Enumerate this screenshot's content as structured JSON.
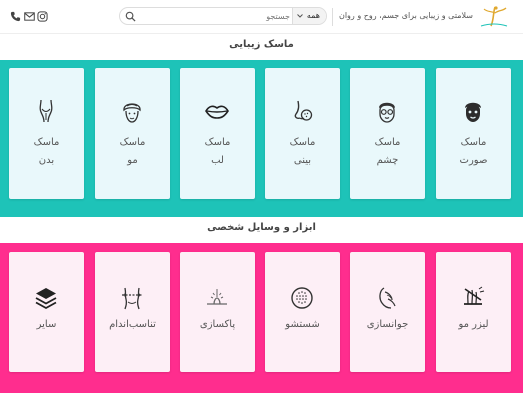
{
  "header": {
    "tagline": "سلامتی و زیبایی برای جسم، روح و روان",
    "search": {
      "placeholder": "جستجو",
      "category": "همه"
    },
    "social": [
      "instagram-icon",
      "email-icon",
      "phone-icon"
    ]
  },
  "sections": [
    {
      "title": "ماسک زیبایی",
      "color": "#1ec3b8",
      "items": [
        {
          "icon": "face-mask-icon",
          "line1": "ماسک",
          "line2": "صورت"
        },
        {
          "icon": "eye-mask-icon",
          "line1": "ماسک",
          "line2": "چشم"
        },
        {
          "icon": "nose-mask-icon",
          "line1": "ماسک",
          "line2": "بینی"
        },
        {
          "icon": "lips-icon",
          "line1": "ماسک",
          "line2": "لب"
        },
        {
          "icon": "hair-mask-icon",
          "line1": "ماسک",
          "line2": "مو"
        },
        {
          "icon": "body-icon",
          "line1": "ماسک",
          "line2": "بدن"
        }
      ]
    },
    {
      "title": "ابزار و وسایل شخصی",
      "color": "#ff2d8e",
      "items": [
        {
          "icon": "laser-hair-removal-icon",
          "line1": "لیزر مو"
        },
        {
          "icon": "rejuvenation-icon",
          "line1": "جوانسازی"
        },
        {
          "icon": "cleansing-brush-icon",
          "line1": "شستشو"
        },
        {
          "icon": "pore-cleaning-icon",
          "line1": "پاکسازی"
        },
        {
          "icon": "body-shaping-icon",
          "line1": "تناسب‌اندام"
        },
        {
          "icon": "layers-icon",
          "line1": "سایر"
        }
      ]
    }
  ]
}
